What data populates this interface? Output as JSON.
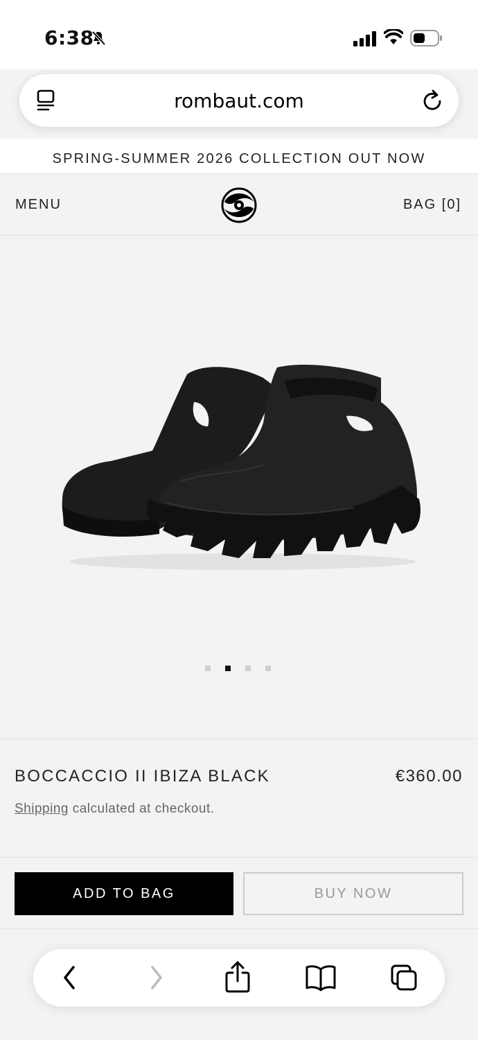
{
  "status_bar": {
    "time": "6:38",
    "icons": [
      "bell-slash-icon",
      "signal-icon",
      "wifi-icon",
      "battery-icon"
    ]
  },
  "browser": {
    "url": "rombaut.com",
    "icons": [
      "reader-icon",
      "reload-icon"
    ]
  },
  "announcement": {
    "text": "SPRING-SUMMER 2026 COLLECTION OUT NOW"
  },
  "header": {
    "menu_label": "MENU",
    "bag_label": "BAG [0]",
    "logo": "rombaut-logo"
  },
  "gallery": {
    "slide_count": 4,
    "active_index": 1
  },
  "product": {
    "title": "BOCCACCIO II IBIZA BLACK",
    "price": "€360.00",
    "shipping_link": "Shipping",
    "shipping_rest": " calculated at checkout."
  },
  "actions": {
    "add_to_bag_label": "ADD TO BAG",
    "buy_now_label": "BUY NOW"
  },
  "toolbar": {
    "icons": [
      "back-icon",
      "forward-icon",
      "share-icon",
      "bookmarks-icon",
      "tabs-icon"
    ]
  },
  "colors": {
    "background": "#f3f3f3",
    "primary_button": "#000000",
    "primary_button_text": "#ffffff",
    "secondary_button_text": "#999999"
  }
}
